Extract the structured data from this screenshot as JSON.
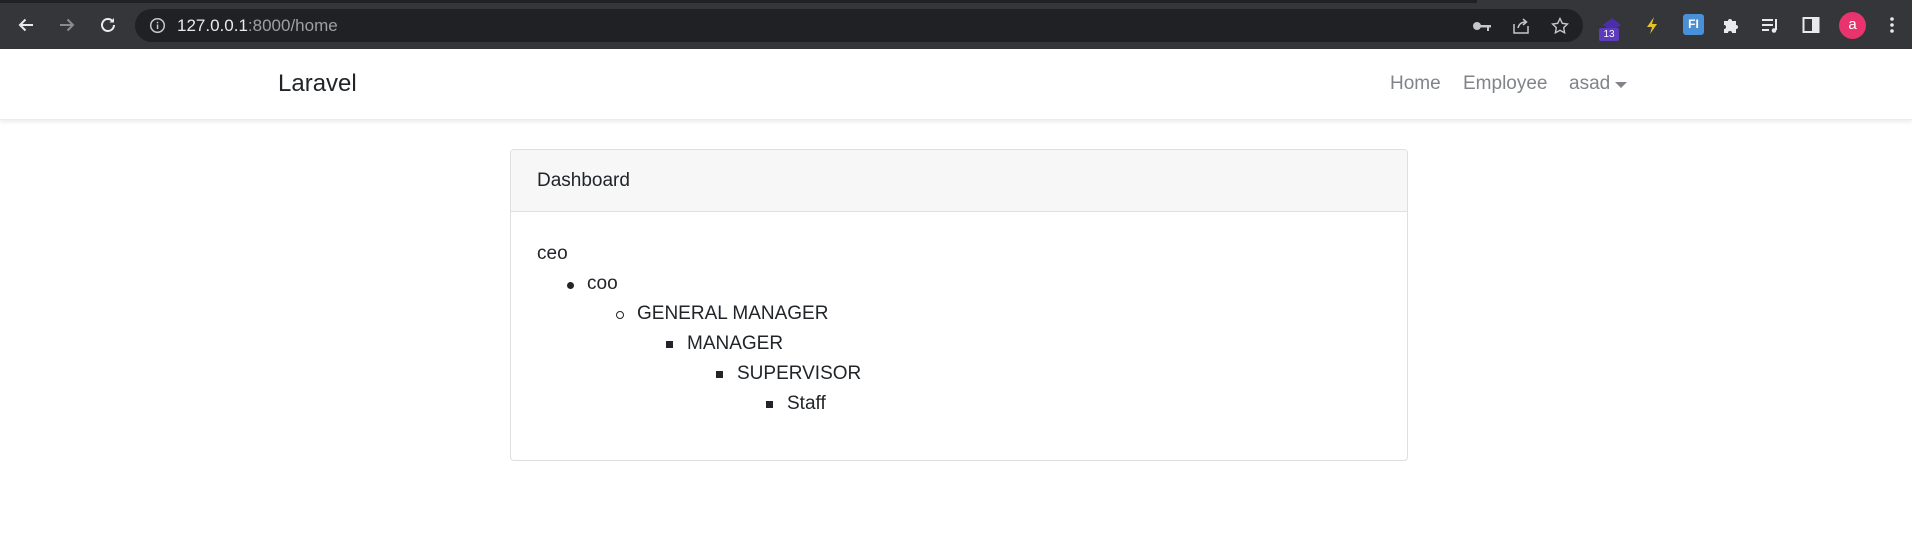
{
  "browser": {
    "url_host": "127.0.0.1",
    "url_path": ":8000/home",
    "extension_badge_count": "13",
    "extension_fi_label": "FI",
    "profile_initial": "a",
    "icons": [
      "back-icon",
      "forward-icon",
      "reload-icon",
      "site-info-icon",
      "key-icon",
      "share-icon",
      "bookmark-star-icon",
      "extension-icon",
      "extensions-puzzle-icon",
      "media-queue-icon",
      "side-panel-icon",
      "menu-kebab-icon"
    ]
  },
  "navbar": {
    "brand": "Laravel",
    "links": [
      "Home",
      "Employee"
    ],
    "user": "asad"
  },
  "card": {
    "title": "Dashboard",
    "hierarchy": {
      "root": "ceo",
      "levels": [
        "coo",
        "GENERAL MANAGER",
        "MANAGER",
        "SUPERVISOR",
        "Staff"
      ]
    }
  },
  "colors": {
    "chrome_bg": "#35363a",
    "omnibox_bg": "#202124",
    "avatar": "#e8336d",
    "nav_link": "#808489",
    "text": "#212529",
    "card_header_bg": "#f7f7f7"
  }
}
